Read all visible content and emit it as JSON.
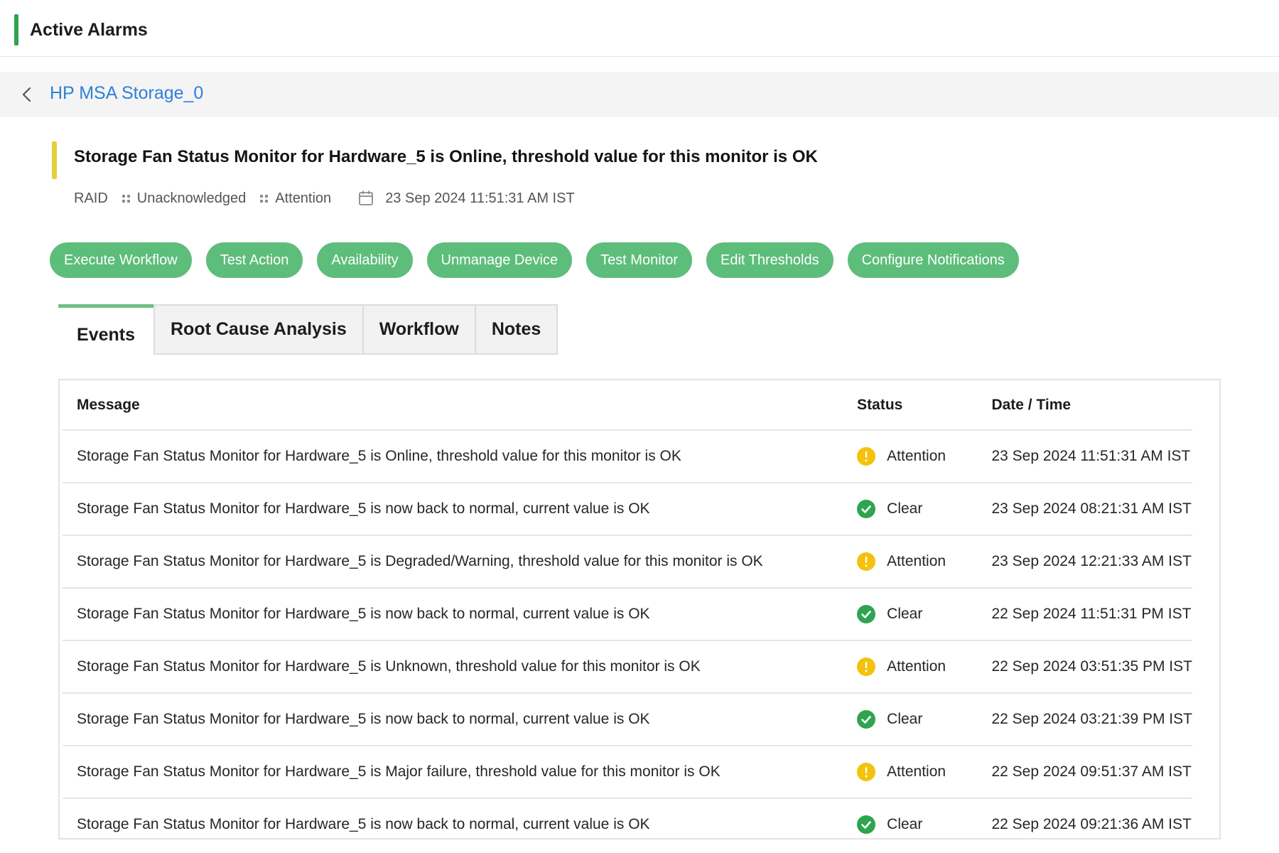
{
  "header": {
    "title": "Active Alarms",
    "accent_color": "#2ea44f"
  },
  "device": {
    "name": "HP MSA Storage_0",
    "back_icon": "chevron-left-icon"
  },
  "alarm": {
    "title": "Storage Fan Status Monitor for Hardware_5 is Online, threshold value for this monitor is OK",
    "accent_color": "#e3d03e",
    "category": "RAID",
    "ack_state": "Unacknowledged",
    "severity": "Attention",
    "date": "23 Sep 2024 11:51:31 AM IST"
  },
  "actions": [
    "Execute Workflow",
    "Test Action",
    "Availability",
    "Unmanage Device",
    "Test Monitor",
    "Edit Thresholds",
    "Configure Notifications"
  ],
  "tabs": [
    "Events",
    "Root Cause Analysis",
    "Workflow",
    "Notes"
  ],
  "events_table": {
    "columns": [
      "Message",
      "Status",
      "Date / Time"
    ],
    "rows": [
      {
        "message": "Storage Fan Status Monitor for Hardware_5 is Online, threshold value for this monitor is OK",
        "status": "Attention",
        "date": "23 Sep 2024 11:51:31 AM IST"
      },
      {
        "message": "Storage Fan Status Monitor for Hardware_5 is now back to normal, current value is OK",
        "status": "Clear",
        "date": "23 Sep 2024 08:21:31 AM IST"
      },
      {
        "message": "Storage Fan Status Monitor for Hardware_5 is Degraded/Warning, threshold value for this monitor is OK",
        "status": "Attention",
        "date": "23 Sep 2024 12:21:33 AM IST"
      },
      {
        "message": "Storage Fan Status Monitor for Hardware_5 is now back to normal, current value is OK",
        "status": "Clear",
        "date": "22 Sep 2024 11:51:31 PM IST"
      },
      {
        "message": "Storage Fan Status Monitor for Hardware_5 is Unknown, threshold value for this monitor is OK",
        "status": "Attention",
        "date": "22 Sep 2024 03:51:35 PM IST"
      },
      {
        "message": "Storage Fan Status Monitor for Hardware_5 is now back to normal, current value is OK",
        "status": "Clear",
        "date": "22 Sep 2024 03:21:39 PM IST"
      },
      {
        "message": "Storage Fan Status Monitor for Hardware_5 is Major failure, threshold value for this monitor is OK",
        "status": "Attention",
        "date": "22 Sep 2024 09:51:37 AM IST"
      },
      {
        "message": "Storage Fan Status Monitor for Hardware_5 is now back to normal, current value is OK",
        "status": "Clear",
        "date": "22 Sep 2024 09:21:36 AM IST"
      }
    ]
  },
  "colors": {
    "action_button": "#5dbd7a",
    "link": "#2f80d8",
    "attention": "#f4c20d",
    "clear": "#2ea44f"
  }
}
